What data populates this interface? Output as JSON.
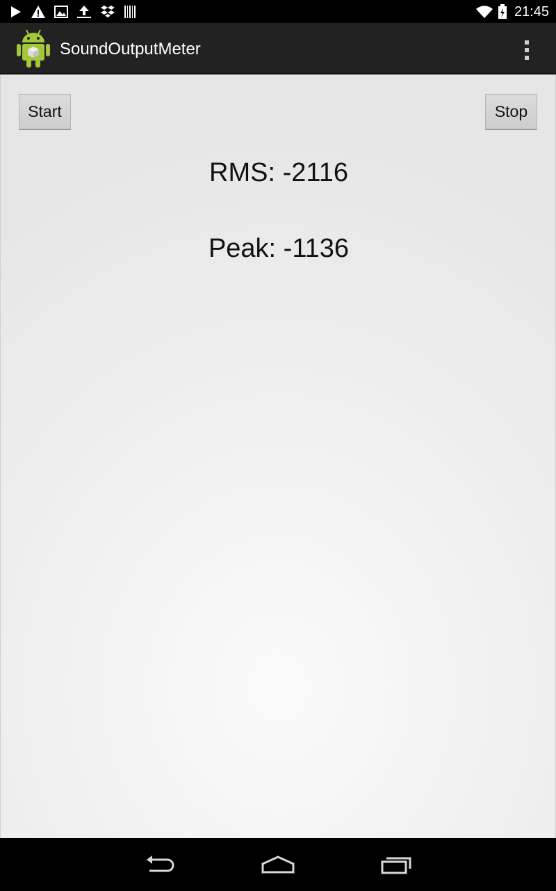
{
  "status_bar": {
    "icons_left": [
      "play-store-icon",
      "warning-icon",
      "image-icon",
      "upload-icon",
      "dropbox-icon",
      "barcode-icon"
    ],
    "icons_right": [
      "wifi-icon",
      "battery-icon"
    ],
    "time": "21:45"
  },
  "action_bar": {
    "app_icon": "android-app-icon",
    "title": "SoundOutputMeter",
    "overflow_icon": "overflow-menu-icon"
  },
  "main": {
    "start_label": "Start",
    "stop_label": "Stop",
    "rms_text": "RMS: -2116",
    "peak_text": "Peak: -1136"
  },
  "nav_bar": {
    "icons": [
      "back-icon",
      "home-icon",
      "recents-icon"
    ]
  },
  "colors": {
    "action_bar_bg": "#222222",
    "status_bar_bg": "#000000",
    "android_green": "#a4c639",
    "content_bg": "#eeeeee"
  }
}
